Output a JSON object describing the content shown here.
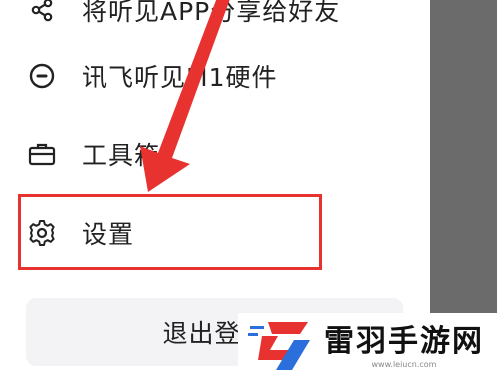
{
  "menu": {
    "items": [
      {
        "label": "将听见APP分享给好友",
        "icon": "share-icon"
      },
      {
        "label": "讯飞听见M1硬件",
        "icon": "recorder-device-icon"
      },
      {
        "label": "工具箱",
        "icon": "toolbox-icon"
      },
      {
        "label": "设置",
        "icon": "gear-icon"
      }
    ]
  },
  "logout": {
    "label": "退出登录"
  },
  "annotation": {
    "highlight_color": "#e8322f",
    "arrow_color": "#e8322f"
  },
  "scrim_color": "#6b6b6b",
  "watermark": {
    "name": "雷羽手游网",
    "url": "www.leiucn.com"
  }
}
